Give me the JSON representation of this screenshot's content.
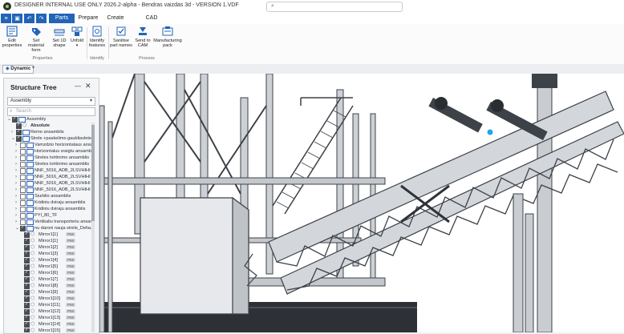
{
  "window": {
    "title": "DESIGNER INTERNAL USE ONLY 2026.2-alpha - Bendras vaizdas 3d - VERSION 1.VDF"
  },
  "tabs": [
    {
      "label": "Parts",
      "active": true
    },
    {
      "label": "Prepare",
      "active": false
    },
    {
      "label": "Create",
      "active": false
    },
    {
      "label": "CAD Commands",
      "active": false
    }
  ],
  "ribbon": {
    "buttons": [
      {
        "label": "Edit properties",
        "icon": "edit-properties-icon"
      },
      {
        "label": "Set material form",
        "icon": "material-tag-icon"
      },
      {
        "label": "Set 1D shape",
        "icon": "shape-1d-icon"
      },
      {
        "label": "Unfold",
        "icon": "unfold-icon"
      },
      {
        "label": "Identify features",
        "icon": "identify-features-icon"
      },
      {
        "label": "Sanitise part names",
        "icon": "sanitise-names-icon"
      },
      {
        "label": "Send to CAM",
        "icon": "send-to-cam-icon"
      },
      {
        "label": "Manufacturing pack",
        "icon": "manufacturing-pack-icon"
      }
    ],
    "groups": [
      {
        "label": "Properties"
      },
      {
        "label": "Identify"
      },
      {
        "label": "Process"
      }
    ]
  },
  "view": {
    "mode": "Dynamic"
  },
  "structure_tree": {
    "title": "Structure Tree",
    "assembly_select": "Assembly",
    "search_placeholder": "Search",
    "items": [
      {
        "label": "Assembly",
        "expand": "-",
        "check": "partial",
        "kind": "folder",
        "indent": 0
      },
      {
        "label": "Absolute",
        "expand": "",
        "check": "on",
        "kind": "cube",
        "indent": 1,
        "bold": true
      },
      {
        "label": "Remo ansamblis",
        "expand": ">",
        "check": "on",
        "kind": "folder",
        "indent": 1
      },
      {
        "label": "Strele +paskelimo gaubliavlete",
        "expand": "v",
        "check": "on",
        "kind": "folder",
        "indent": 1
      },
      {
        "label": "Vamzdzio horizontalaus ansa",
        "expand": ">",
        "check": "off",
        "kind": "folder",
        "indent": 2
      },
      {
        "label": "Horizontalus sraigtu ansambl",
        "expand": ">",
        "check": "off",
        "kind": "folder",
        "indent": 2
      },
      {
        "label": "Streles tvirtinimo ansamblis",
        "expand": ">",
        "check": "off",
        "kind": "folder",
        "indent": 2
      },
      {
        "label": "Streles tvirtinimo ansamblis",
        "expand": ">",
        "check": "off",
        "kind": "folder",
        "indent": 2
      },
      {
        "label": "NNF_5016_ADB_2LSVHIHI",
        "expand": ">",
        "check": "off",
        "kind": "folder",
        "indent": 2
      },
      {
        "label": "NNF_5016_ADB_2LSVHIHI",
        "expand": ">",
        "check": "off",
        "kind": "folder",
        "indent": 2
      },
      {
        "label": "NNF_5016_ADB_2LSVHIHI",
        "expand": ">",
        "check": "off",
        "kind": "folder",
        "indent": 2
      },
      {
        "label": "NNF_5016_ADB_2LSVHIHI",
        "expand": ">",
        "check": "off",
        "kind": "folder",
        "indent": 2
      },
      {
        "label": "Siurblio ansamblis",
        "expand": ">",
        "check": "off",
        "kind": "folder",
        "indent": 2
      },
      {
        "label": "Kridiniu dviraju ansamblis",
        "expand": ">",
        "check": "off",
        "kind": "folder",
        "indent": 2
      },
      {
        "label": "Kridiniu dviraju ansamblis",
        "expand": ">",
        "check": "off",
        "kind": "folder",
        "indent": 2
      },
      {
        "label": "PYI_80_TF",
        "expand": ">",
        "check": "off",
        "kind": "folder",
        "indent": 2
      },
      {
        "label": "Vertikaliu transporteriu ansar",
        "expand": ">",
        "check": "off",
        "kind": "folder",
        "indent": 2
      },
      {
        "label": "nu daroni nauja strele_Defau",
        "expand": "v",
        "check": "on",
        "kind": "folder",
        "indent": 2
      },
      {
        "label": "Mirror1[1]",
        "expand": "",
        "check": "on",
        "kind": "cube",
        "indent": 3,
        "pmi": "PMI"
      },
      {
        "label": "Mirror1[1]",
        "expand": "",
        "check": "on",
        "kind": "cube",
        "indent": 3,
        "pmi": "PMI"
      },
      {
        "label": "Mirror1[2]",
        "expand": "",
        "check": "on",
        "kind": "cube",
        "indent": 3,
        "pmi": "PMI"
      },
      {
        "label": "Mirror1[3]",
        "expand": "",
        "check": "on",
        "kind": "cube",
        "indent": 3,
        "pmi": "PMI"
      },
      {
        "label": "Mirror1[4]",
        "expand": "",
        "check": "on",
        "kind": "cube",
        "indent": 3,
        "pmi": "PMI"
      },
      {
        "label": "Mirror1[5]",
        "expand": "",
        "check": "on",
        "kind": "cube",
        "indent": 3,
        "pmi": "PMI"
      },
      {
        "label": "Mirror1[6]",
        "expand": "",
        "check": "on",
        "kind": "cube",
        "indent": 3,
        "pmi": "PMI"
      },
      {
        "label": "Mirror1[7]",
        "expand": "",
        "check": "on",
        "kind": "cube",
        "indent": 3,
        "pmi": "PMI"
      },
      {
        "label": "Mirror1[8]",
        "expand": "",
        "check": "on",
        "kind": "cube",
        "indent": 3,
        "pmi": "PMI"
      },
      {
        "label": "Mirror1[9]",
        "expand": "",
        "check": "on",
        "kind": "cube",
        "indent": 3,
        "pmi": "PMI"
      },
      {
        "label": "Mirror1[10]",
        "expand": "",
        "check": "on",
        "kind": "cube",
        "indent": 3,
        "pmi": "PMI"
      },
      {
        "label": "Mirror1[11]",
        "expand": "",
        "check": "on",
        "kind": "cube",
        "indent": 3,
        "pmi": "PMI"
      },
      {
        "label": "Mirror1[12]",
        "expand": "",
        "check": "on",
        "kind": "cube",
        "indent": 3,
        "pmi": "PMI"
      },
      {
        "label": "Mirror1[13]",
        "expand": "",
        "check": "on",
        "kind": "cube",
        "indent": 3,
        "pmi": "PMI"
      },
      {
        "label": "Mirror1[14]",
        "expand": "",
        "check": "on",
        "kind": "cube",
        "indent": 3,
        "pmi": "PMI"
      },
      {
        "label": "Mirror1[15]",
        "expand": "",
        "check": "on",
        "kind": "cube",
        "indent": 3,
        "pmi": "PMI"
      },
      {
        "label": "Mirror1[16]",
        "expand": "",
        "check": "on",
        "kind": "cube",
        "indent": 3,
        "pmi": "PMI"
      }
    ]
  },
  "colors": {
    "accent": "#2364b7",
    "viewport_bg": "#ffffff",
    "steel_light": "#c9cdd2",
    "steel_dark": "#3d4248",
    "selection": "#1fa8e8"
  }
}
